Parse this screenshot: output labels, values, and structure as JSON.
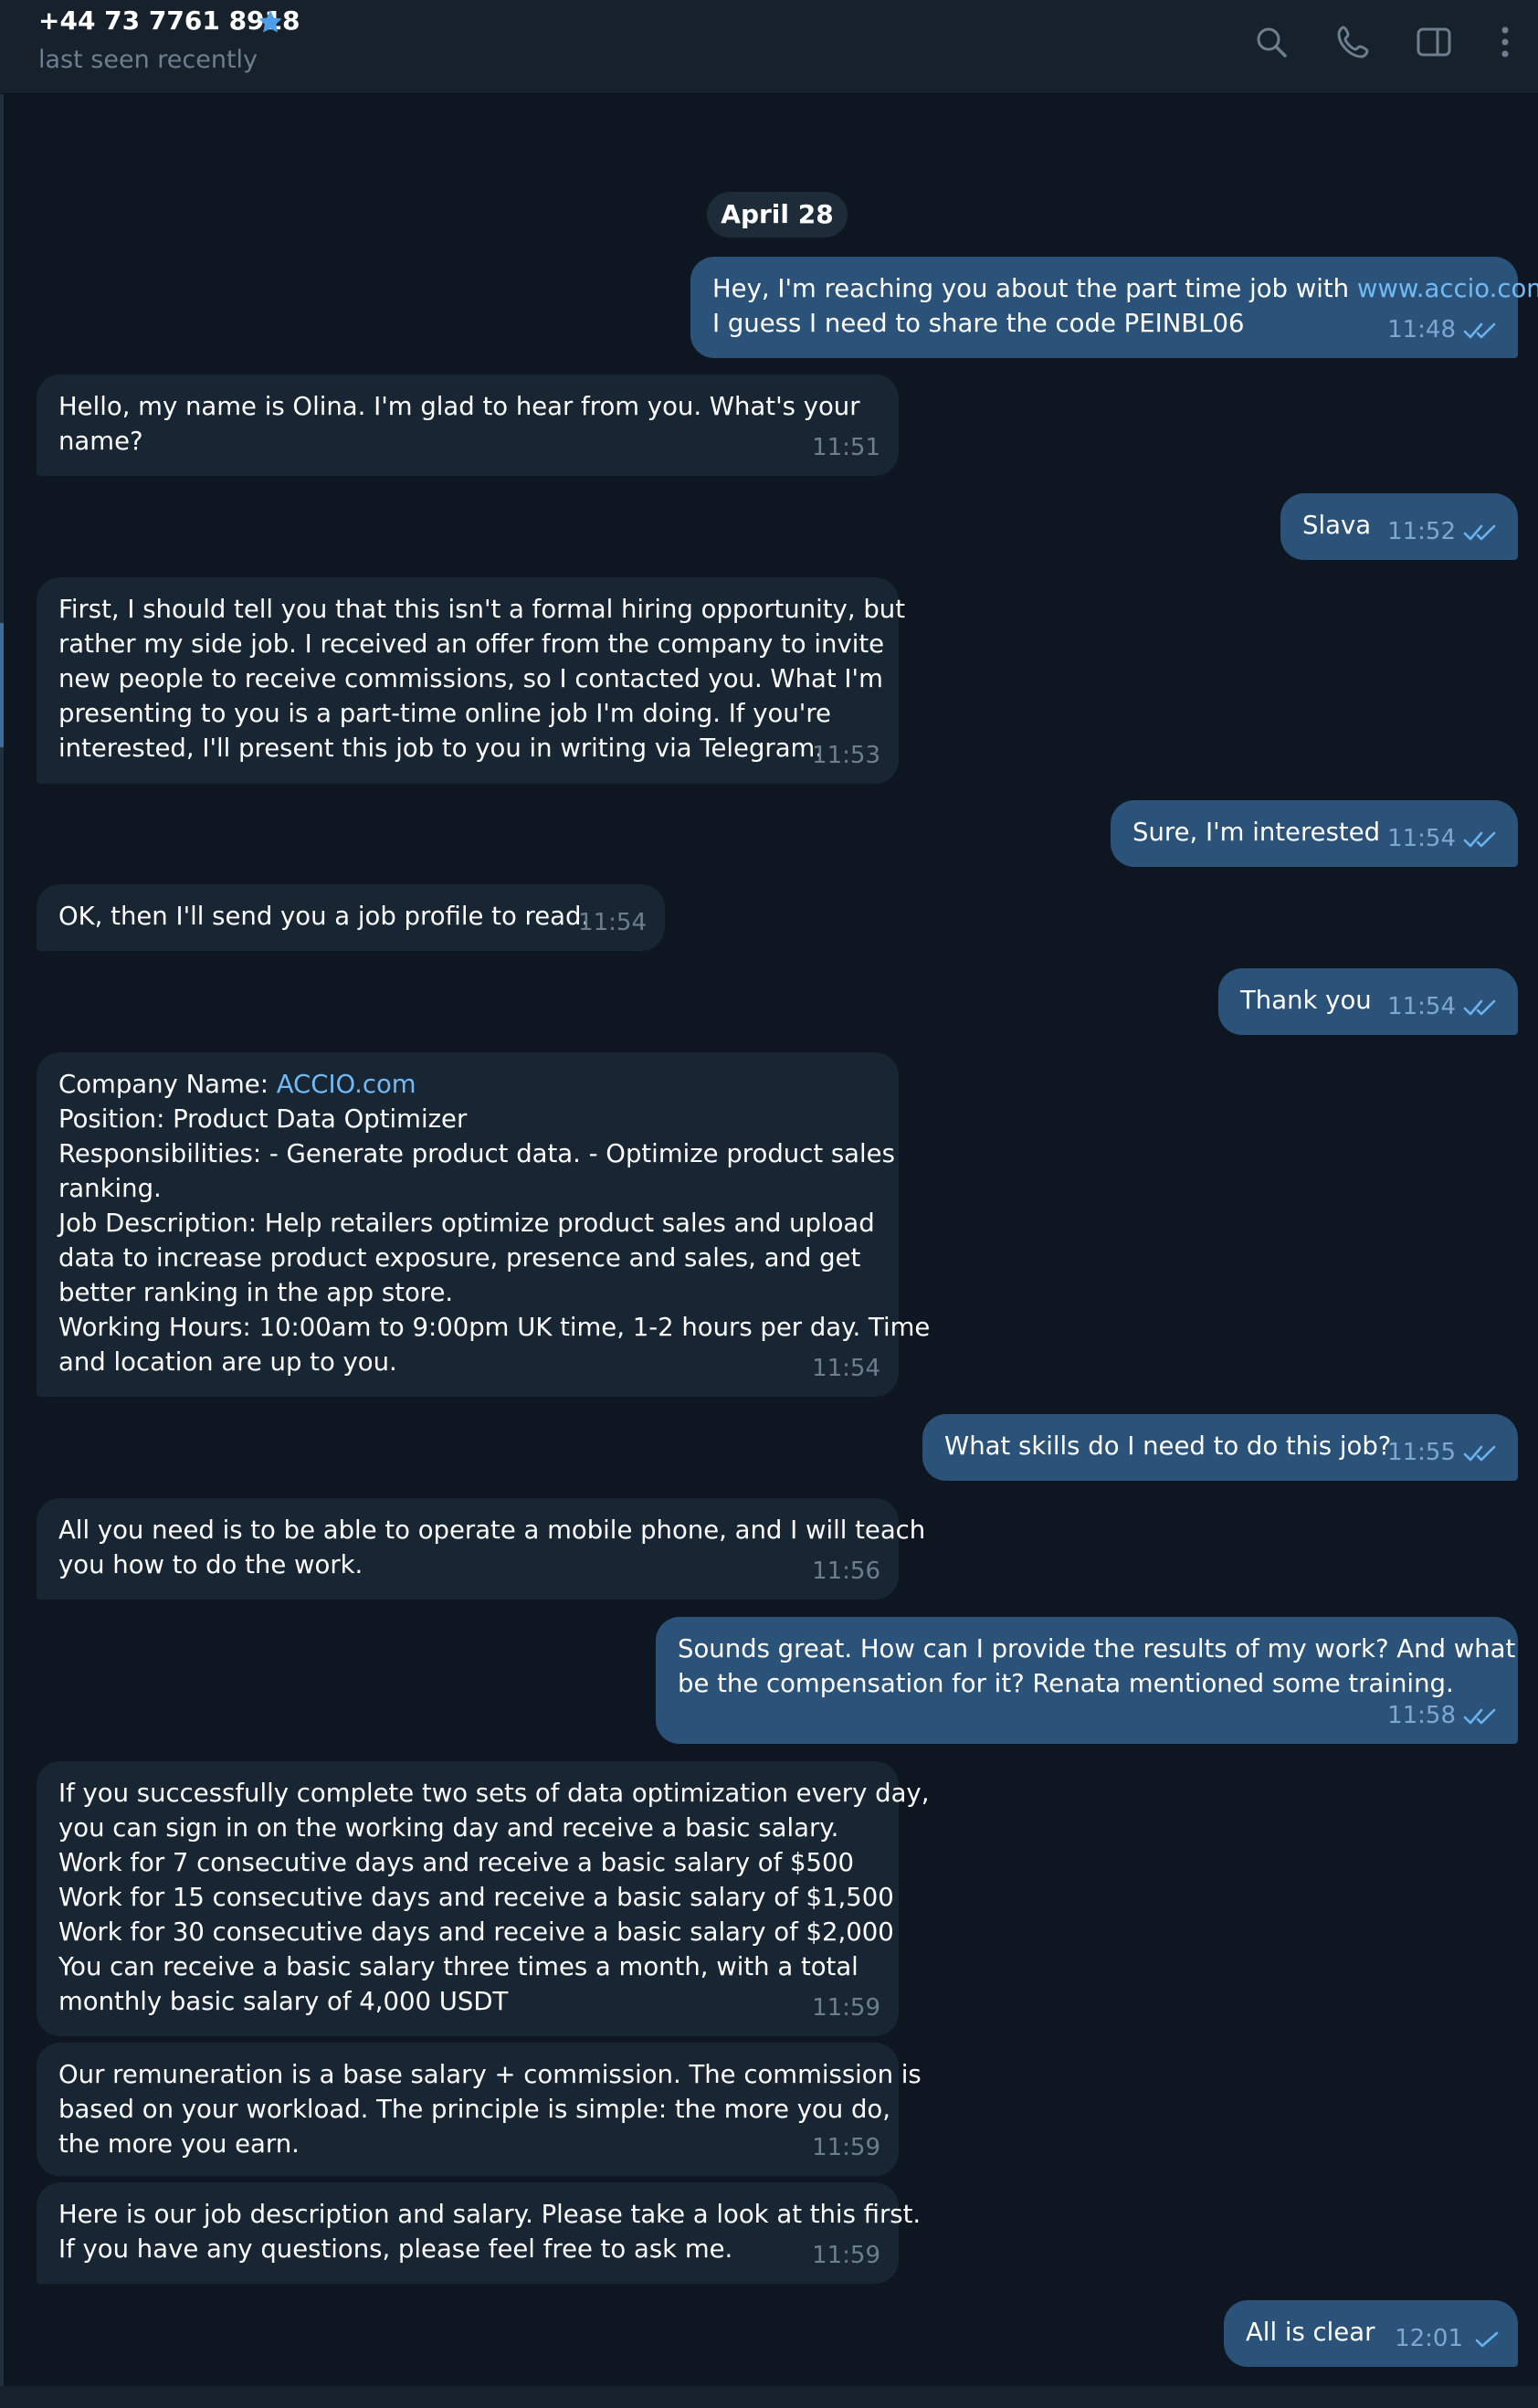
{
  "header": {
    "title": "+44 73 7761 8918",
    "status": "last seen recently",
    "verified_icon": "star-icon",
    "actions": [
      "search-icon",
      "phone-icon",
      "sidebar-panel-icon",
      "more-vertical-icon"
    ]
  },
  "date_separator": "April 28",
  "colors": {
    "background": "#0e1621",
    "incoming_bubble": "#182533",
    "outgoing_bubble": "#2b5278",
    "link": "#71baf5",
    "read_checks": "#6ab3f3"
  },
  "messages": [
    {
      "dir": "out",
      "lines": [
        "Hey, I'm reaching you about the part time job with ",
        "I guess I need to share the code PEINBL06"
      ],
      "link": "www.accio.com",
      "time": "11:48",
      "status": "read"
    },
    {
      "dir": "in",
      "lines": [
        "Hello, my name is Olina. I'm glad to hear from you. What's your",
        "name?"
      ],
      "time": "11:51"
    },
    {
      "dir": "out",
      "lines": [
        "Slava"
      ],
      "time": "11:52",
      "status": "read"
    },
    {
      "dir": "in",
      "lines": [
        "First, I should tell you that this isn't a formal hiring opportunity, but",
        "rather my side job. I received an offer from the company to invite",
        "new people to receive commissions, so I contacted you. What I'm",
        "presenting to you is a part-time online job I'm doing. If you're",
        "interested, I'll present this job to you in writing via Telegram."
      ],
      "time": "11:53"
    },
    {
      "dir": "out",
      "lines": [
        "Sure, I'm interested"
      ],
      "time": "11:54",
      "status": "read"
    },
    {
      "dir": "in",
      "lines": [
        "OK, then I'll send you a job profile to read."
      ],
      "time": "11:54"
    },
    {
      "dir": "out",
      "lines": [
        "Thank you"
      ],
      "time": "11:54",
      "status": "read"
    },
    {
      "dir": "in",
      "lines": [
        "Company Name: ",
        "Position: Product Data Optimizer",
        "Responsibilities: - Generate product data. - Optimize product sales",
        "ranking.",
        "Job Description: Help retailers optimize product sales and upload",
        "data to increase product exposure, presence and sales, and get",
        "better ranking in the app store.",
        "Working Hours: 10:00am to 9:00pm UK time, 1-2 hours per day. Time",
        "and location are up to you."
      ],
      "link": "ACCIO.com",
      "time": "11:54"
    },
    {
      "dir": "out",
      "lines": [
        "What skills do I need to do this job?"
      ],
      "time": "11:55",
      "status": "read"
    },
    {
      "dir": "in",
      "lines": [
        "All you need is to be able to operate a mobile phone, and I will teach",
        "you how to do the work."
      ],
      "time": "11:56"
    },
    {
      "dir": "out",
      "lines": [
        "Sounds great. How can I provide the results of my work? And what",
        "be the compensation for it? Renata mentioned some training."
      ],
      "time": "11:58",
      "status": "read"
    },
    {
      "dir": "in",
      "lines": [
        "If you successfully complete two sets of data optimization every day,",
        "you can sign in on the working day and receive a basic salary.",
        "Work for 7 consecutive days and receive a basic salary of $500",
        "Work for 15 consecutive days and receive a basic salary of $1,500",
        "Work for 30 consecutive days and receive a basic salary of $2,000",
        "You can receive a basic salary three times a month, with a total",
        "monthly basic salary of 4,000 USDT"
      ],
      "time": "11:59"
    },
    {
      "dir": "in",
      "lines": [
        "Our remuneration is a base salary + commission. The commission is",
        "based on your workload. The principle is simple: the more you do,",
        "the more you earn."
      ],
      "time": "11:59"
    },
    {
      "dir": "in",
      "lines": [
        "Here is our job description and salary. Please take a look at this first.",
        "If you have any questions, please feel free to ask me."
      ],
      "time": "11:59"
    },
    {
      "dir": "out",
      "lines": [
        "All is clear"
      ],
      "time": "12:01",
      "status": "sent"
    }
  ]
}
